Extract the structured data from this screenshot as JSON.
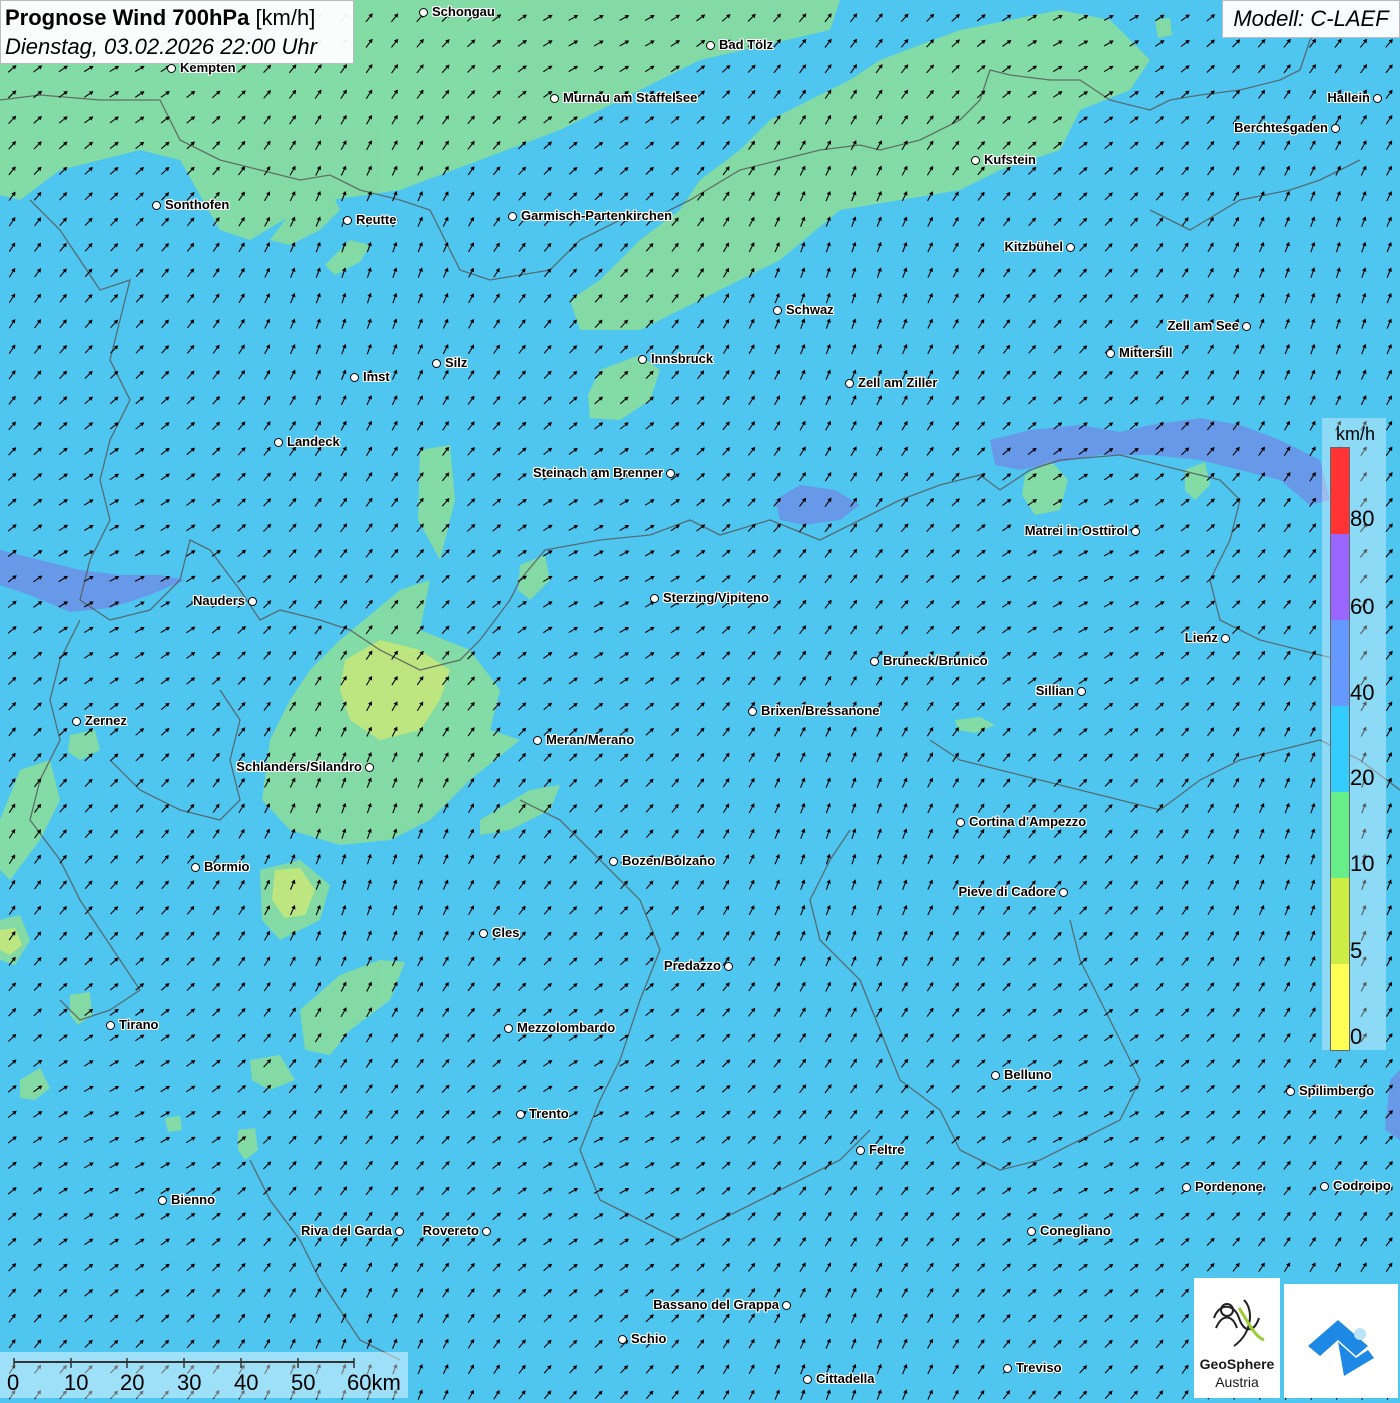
{
  "header": {
    "title_bold": "Prognose Wind 700hPa",
    "title_unit": "[km/h]",
    "datetime": "Dienstag, 03.02.2026 22:00 Uhr",
    "model": "Modell: C-LAEF"
  },
  "legend": {
    "unit": "km/h",
    "ticks": [
      "80",
      "60",
      "40",
      "20",
      "10",
      "5",
      "0"
    ],
    "colors": [
      "#ff3333",
      "#9966ff",
      "#6699ff",
      "#33ccff",
      "#66ee88",
      "#ccee44",
      "#ffff55"
    ]
  },
  "map": {
    "background_color": "#4fc6f0",
    "light_zone_color": "#86dca0",
    "yellow_zone_color": "#c8e87a",
    "purple_zone_color": "#6f8ae6",
    "arrow_color": "#000000",
    "border_color": "#555555"
  },
  "cities": [
    {
      "name": "Schongau"
    },
    {
      "name": "Bad Tölz"
    },
    {
      "name": "Kempten"
    },
    {
      "name": "Murnau am Staffelsee"
    },
    {
      "name": "Hallein"
    },
    {
      "name": "Berchtesgaden"
    },
    {
      "name": "Kufstein"
    },
    {
      "name": "Sonthofen"
    },
    {
      "name": "Reutte"
    },
    {
      "name": "Garmisch-Partenkirchen"
    },
    {
      "name": "Kitzbühel"
    },
    {
      "name": "Schwaz"
    },
    {
      "name": "Zell am See"
    },
    {
      "name": "Mittersill"
    },
    {
      "name": "Innsbruck"
    },
    {
      "name": "Silz"
    },
    {
      "name": "Imst"
    },
    {
      "name": "Zell am Ziller"
    },
    {
      "name": "Landeck"
    },
    {
      "name": "Steinach am Brenner"
    },
    {
      "name": "Matrei in Osttirol"
    },
    {
      "name": "Nauders"
    },
    {
      "name": "Sterzing/Vipiteno"
    },
    {
      "name": "Lienz"
    },
    {
      "name": "Bruneck/Brunico"
    },
    {
      "name": "Sillian"
    },
    {
      "name": "Zernez"
    },
    {
      "name": "Brixen/Bressanone"
    },
    {
      "name": "Meran/Merano"
    },
    {
      "name": "Schlanders/Silandro"
    },
    {
      "name": "Cortina d'Ampezzo"
    },
    {
      "name": "Bozen/Bolzano"
    },
    {
      "name": "Bormio"
    },
    {
      "name": "Pieve di Cadore"
    },
    {
      "name": "Cles"
    },
    {
      "name": "Predazzo"
    },
    {
      "name": "Tirano"
    },
    {
      "name": "Mezzolombardo"
    },
    {
      "name": "Belluno"
    },
    {
      "name": "Spilimbergo"
    },
    {
      "name": "Trento"
    },
    {
      "name": "Feltre"
    },
    {
      "name": "Bienno"
    },
    {
      "name": "Pordenone"
    },
    {
      "name": "Codroipo"
    },
    {
      "name": "Riva del Garda"
    },
    {
      "name": "Rovereto"
    },
    {
      "name": "Conegliano"
    },
    {
      "name": "Bassano del Grappa"
    },
    {
      "name": "Schio"
    },
    {
      "name": "Treviso"
    },
    {
      "name": "Cittadella"
    }
  ],
  "scale": {
    "labels": [
      "0",
      "10",
      "20",
      "30",
      "40",
      "50",
      "60km"
    ]
  },
  "logos": {
    "geosphere_line1": "GeoSphere",
    "geosphere_line2": "Austria"
  }
}
